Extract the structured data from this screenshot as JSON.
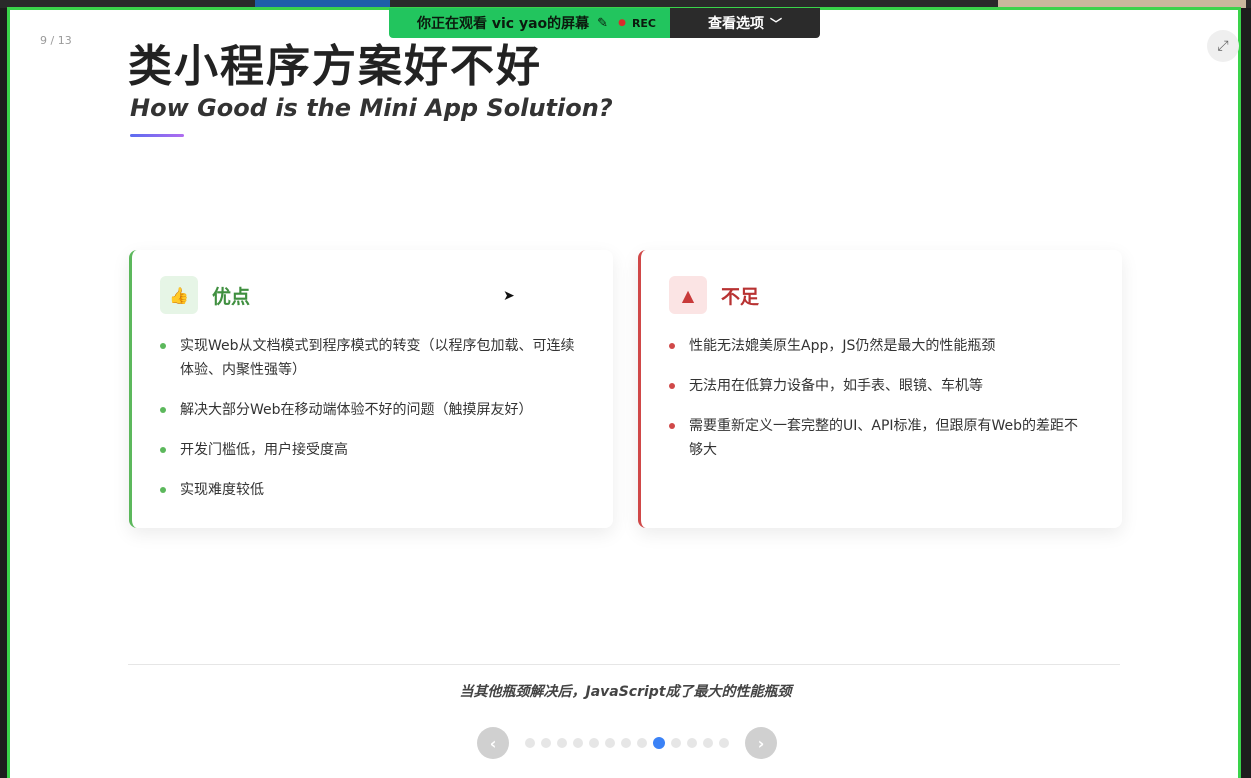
{
  "share_banner": {
    "viewing_text": "你正在观看 vic yao的屏幕",
    "mic_icon": "mic-off-icon",
    "rec_label": "REC",
    "options_label": "查看选项"
  },
  "slide": {
    "page_indicator": "9 / 13",
    "title": "类小程序方案好不好",
    "subtitle": "How Good is the Mini App Solution?",
    "pros": {
      "title": "优点",
      "icon": "thumbs-up-icon",
      "items": [
        "实现Web从文档模式到程序模式的转变（以程序包加载、可连续体验、内聚性强等）",
        "解决大部分Web在移动端体验不好的问题（触摸屏友好）",
        "开发门槛低，用户接受度高",
        "实现难度较低"
      ]
    },
    "cons": {
      "title": "不足",
      "icon": "warning-icon",
      "items": [
        "性能无法媲美原生App，JS仍然是最大的性能瓶颈",
        "无法用在低算力设备中，如手表、眼镜、车机等",
        "需要重新定义一套完整的UI、API标准，但跟原有Web的差距不够大"
      ]
    },
    "footer_note": "当其他瓶颈解决后，JavaScript成了最大的性能瓶颈"
  },
  "pager": {
    "total": 13,
    "current": 9
  },
  "colors": {
    "pros": "#5cb85c",
    "cons": "#d04848",
    "share_green": "#22c55e",
    "active_dot": "#3b82f6"
  }
}
